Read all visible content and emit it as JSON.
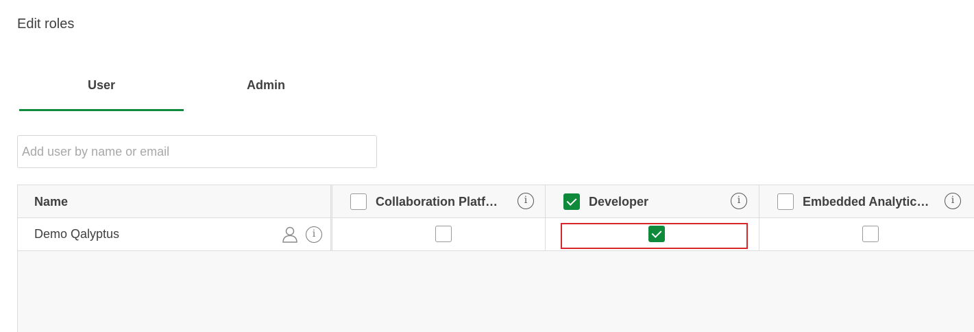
{
  "page": {
    "title": "Edit roles"
  },
  "tabs": [
    {
      "label": "User",
      "active": true
    },
    {
      "label": "Admin",
      "active": false
    }
  ],
  "search": {
    "placeholder": "Add user by name or email",
    "value": ""
  },
  "table": {
    "columns": [
      {
        "label": "Name"
      },
      {
        "label": "Collaboration Platf…",
        "checked": false
      },
      {
        "label": "Developer",
        "checked": true
      },
      {
        "label": "Embedded Analytic…",
        "checked": false
      }
    ],
    "rows": [
      {
        "name": "Demo Qalyptus",
        "collaboration": false,
        "developer": true,
        "embedded": false
      }
    ]
  },
  "icons": {
    "info": "info-icon",
    "user": "user-icon",
    "info_glyph": "i"
  },
  "colors": {
    "accent": "#0f8a3a",
    "highlight": "#d7262b",
    "border": "#dcdcdc",
    "grid_bg": "#f8f8f8"
  }
}
